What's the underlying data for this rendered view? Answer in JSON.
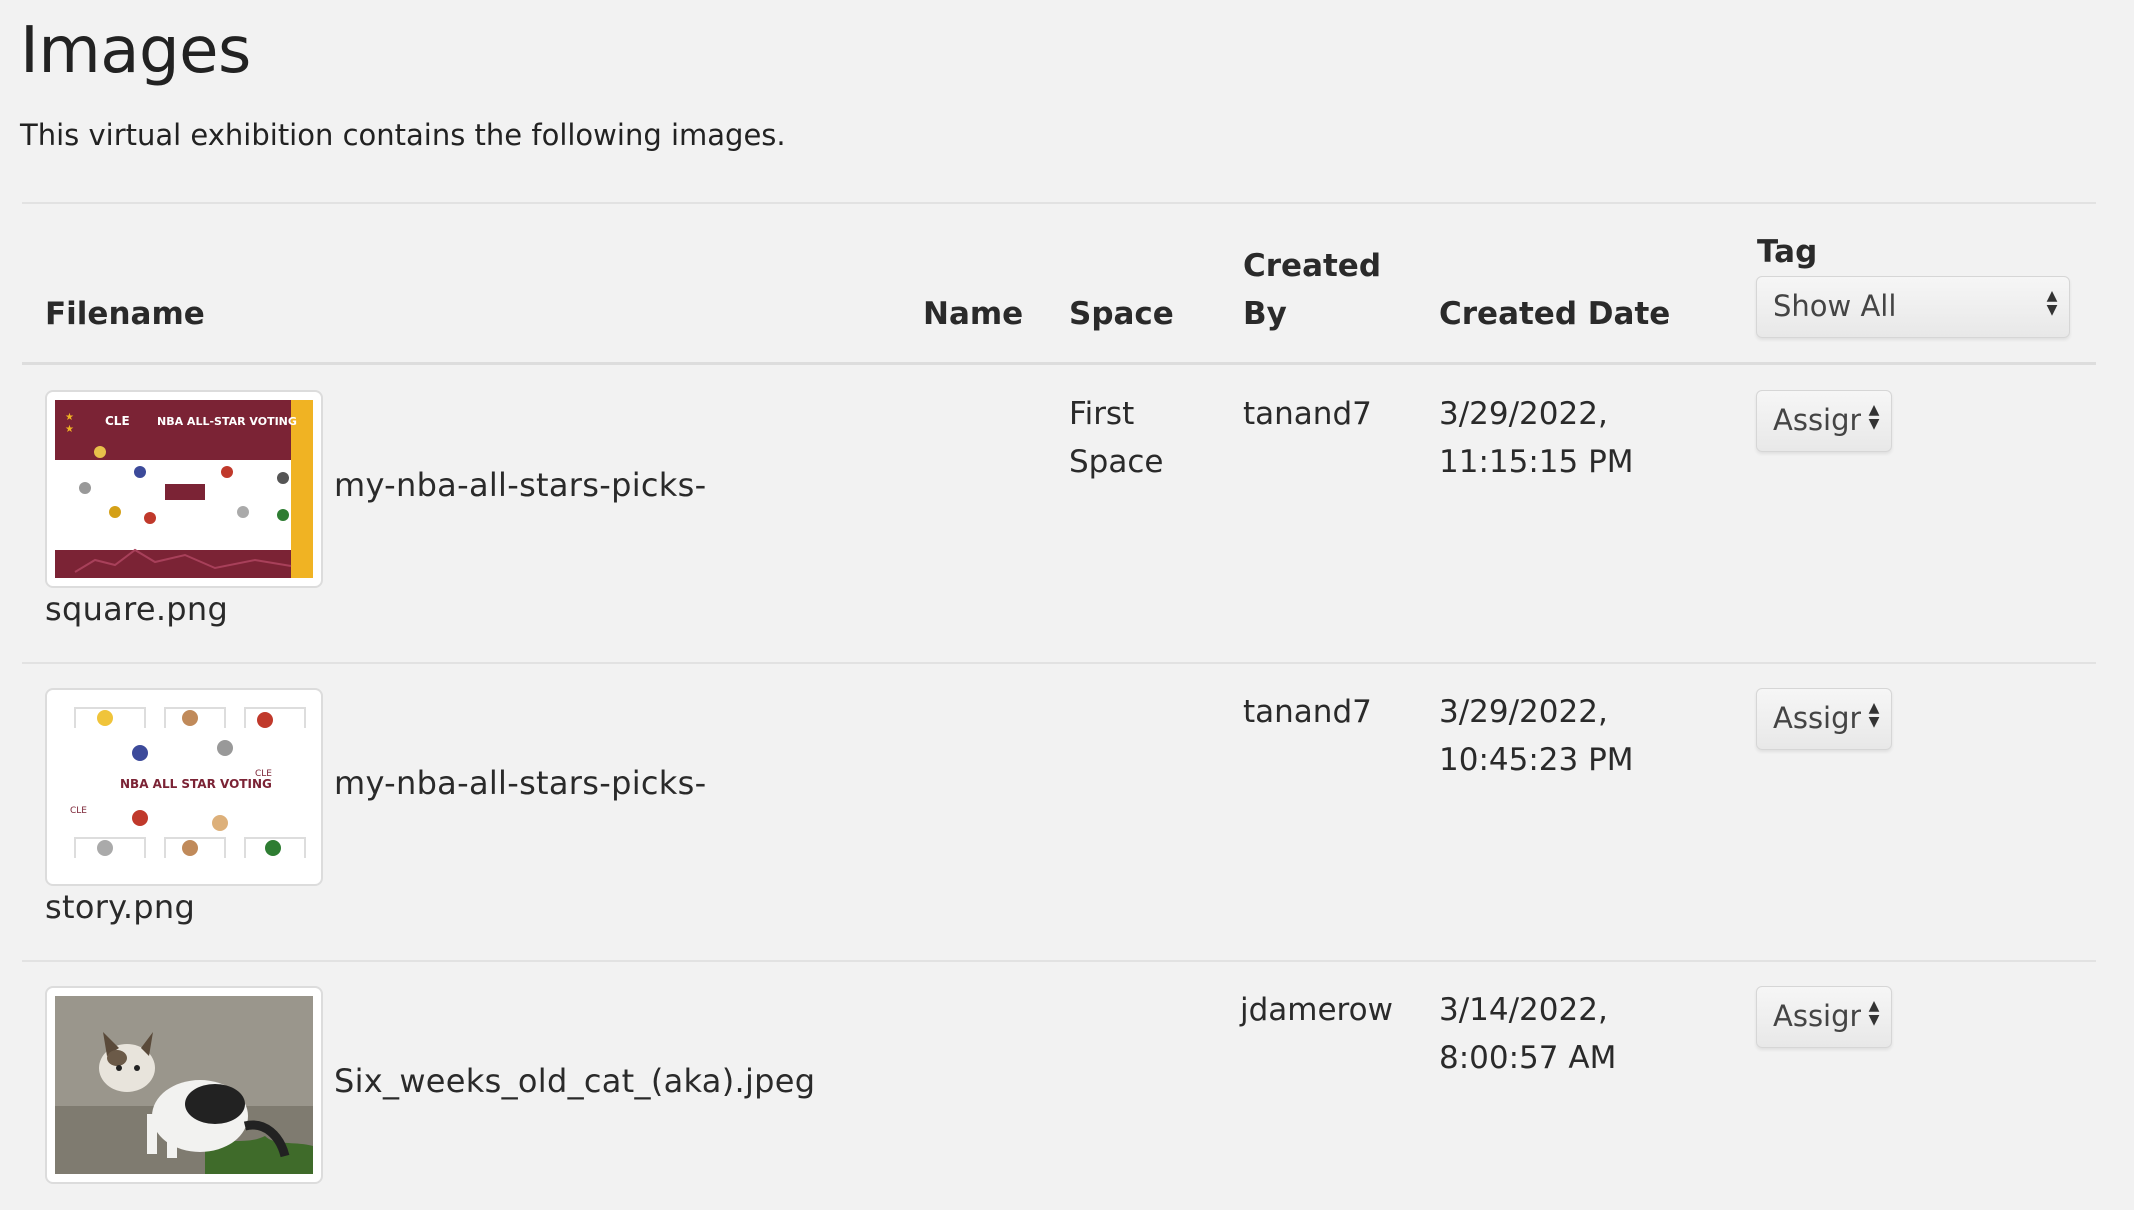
{
  "page": {
    "title": "Images",
    "intro": "This virtual exhibition contains the following images."
  },
  "table": {
    "headers": {
      "filename": "Filename",
      "name": "Name",
      "space": "Space",
      "created_by_line1": "Created",
      "created_by_line2": "By",
      "created_date": "Created Date",
      "tag": "Tag"
    },
    "tag_filter": {
      "selected": "Show All"
    },
    "rows": [
      {
        "thumbnail": "nba-all-star-voting-square",
        "filename_line1": "my-nba-all-stars-picks-",
        "filename_line2": "square.png",
        "name": "",
        "space_line1": "First",
        "space_line2": "Space",
        "created_by": "tanand7",
        "date_line1": "3/29/2022,",
        "date_line2": "11:15:15 PM",
        "tag_select": "Assign"
      },
      {
        "thumbnail": "nba-all-star-voting-story",
        "filename_line1": "my-nba-all-stars-picks-",
        "filename_line2": "story.png",
        "name": "",
        "space_line1": "",
        "space_line2": "",
        "created_by": "tanand7",
        "date_line1": "3/29/2022,",
        "date_line2": "10:45:23 PM",
        "tag_select": "Assign"
      },
      {
        "thumbnail": "kitten-photo",
        "filename_line1": "Six_weeks_old_cat_(aka).jpeg",
        "filename_line2": "",
        "name": "",
        "space_line1": "",
        "space_line2": "",
        "created_by": "jdamerow",
        "date_line1": "3/14/2022,",
        "date_line2": "8:00:57 AM",
        "tag_select": "Assign"
      }
    ]
  },
  "colors": {
    "background": "#f2f2f2",
    "nba_maroon": "#7b2335",
    "nba_gold": "#f0b323"
  }
}
